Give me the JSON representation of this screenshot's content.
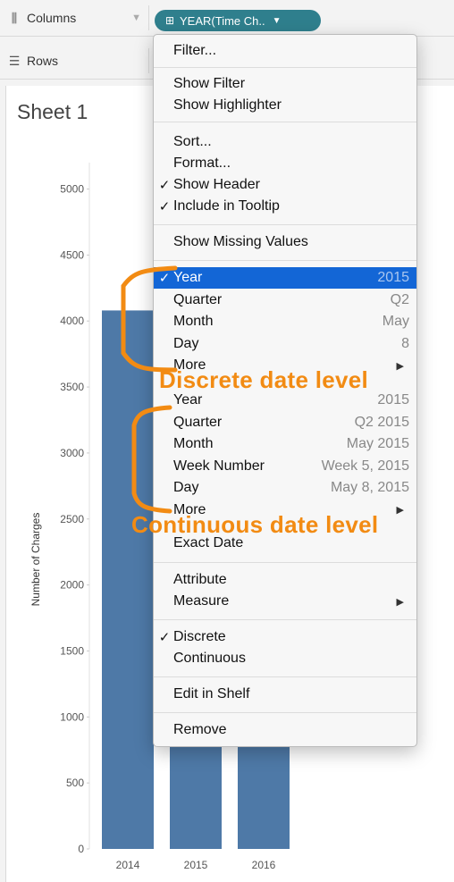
{
  "shelves": {
    "columns": {
      "label": "Columns",
      "icon": "columns-icon",
      "pill_label": "YEAR(Time Ch..",
      "pill_color": "#2f7f8d"
    },
    "rows": {
      "label": "Rows",
      "icon": "rows-icon"
    }
  },
  "sheet": {
    "title": "Sheet 1"
  },
  "chart_data": {
    "type": "bar",
    "categories": [
      "2014",
      "2015",
      "2016"
    ],
    "values": [
      4080,
      4080,
      4080
    ],
    "ylabel": "Number of Charges",
    "xlabel": "",
    "ylim": [
      0,
      5200
    ],
    "yticks": [
      0,
      500,
      1000,
      1500,
      2000,
      2500,
      3000,
      3500,
      4000,
      4500,
      5000
    ],
    "bar_color": "#4e79a7",
    "grid": false
  },
  "menu": {
    "filter": "Filter...",
    "show_filter": "Show Filter",
    "show_highlighter": "Show Highlighter",
    "sort": "Sort...",
    "format": "Format...",
    "show_header": "Show Header",
    "include_tooltip": "Include in Tooltip",
    "show_missing": "Show Missing Values",
    "discrete": [
      {
        "label": "Year",
        "value": "2015",
        "checked": true,
        "selected": true
      },
      {
        "label": "Quarter",
        "value": "Q2"
      },
      {
        "label": "Month",
        "value": "May"
      },
      {
        "label": "Day",
        "value": "8"
      },
      {
        "label": "More",
        "submenu": true
      }
    ],
    "continuous": [
      {
        "label": "Year",
        "value": "2015"
      },
      {
        "label": "Quarter",
        "value": "Q2 2015"
      },
      {
        "label": "Month",
        "value": "May 2015"
      },
      {
        "label": "Week Number",
        "value": "Week 5, 2015"
      },
      {
        "label": "Day",
        "value": "May 8, 2015"
      },
      {
        "label": "More",
        "submenu": true
      }
    ],
    "exact_date": "Exact Date",
    "attribute": "Attribute",
    "measure": "Measure",
    "discrete_opt": "Discrete",
    "continuous_opt": "Continuous",
    "edit_in_shelf": "Edit in Shelf",
    "remove": "Remove",
    "checkmark": "✓",
    "submenu_arrow": "▶"
  },
  "annotations": {
    "discrete_label": "Discrete date level",
    "continuous_label": "Continuous date level",
    "color": "#f28b13"
  }
}
